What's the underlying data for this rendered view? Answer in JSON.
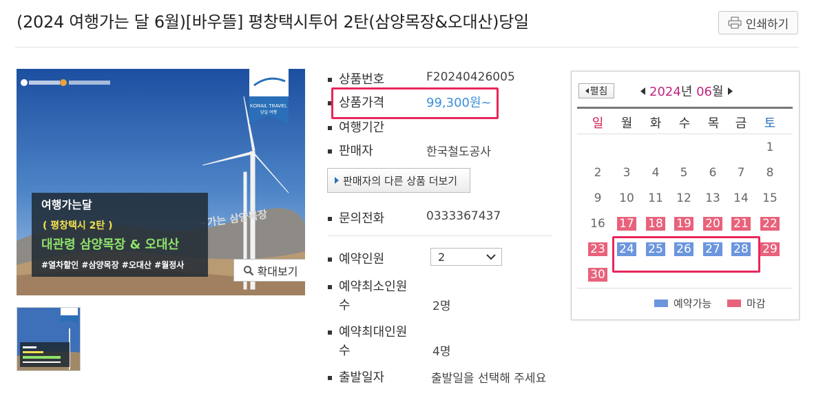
{
  "title": "(2024 여행가는 달 6월)[바우뜰] 평창택시투어 2탄(삼양목장&오대산)당일",
  "print_label": "인쇄하기",
  "zoom_label": "확대보기",
  "banner": {
    "korail_brand": "KORAIL TRAVEL",
    "korail_sub": "당일 여행",
    "headline1": "여행가는달",
    "headline2": "( 평창택시 2탄 )",
    "headline3": "대관령 삼양목장 & 오대산",
    "hashtags": "#열차할인 #삼양목장 #오대산 #월정사",
    "sign": "~가는 삼양목장"
  },
  "info": {
    "product_no_label": "상품번호",
    "product_no": "F20240426005",
    "price_label": "상품가격",
    "price": "99,300원~",
    "period_label": "여행기간",
    "seller_label": "판매자",
    "seller": "한국철도공사",
    "seller_more_label": "판매자의 다른 상품 더보기",
    "phone_label": "문의전화",
    "phone": "0333367437",
    "reserve_people_label": "예약인원",
    "reserve_people_value": "2",
    "min_people_label_1": "예약최소인원",
    "min_people_label_2": "수",
    "min_people": "2명",
    "max_people_label_1": "예약최대인원",
    "max_people_label_2": "수",
    "max_people": "4명",
    "depart_label": "출발일자",
    "depart_value": "출발일을 선택해 주세요"
  },
  "calendar": {
    "fold_label": "펼침",
    "year": "2024",
    "year_suffix": "년",
    "month": "06",
    "month_suffix": "월",
    "weekdays": [
      "일",
      "월",
      "화",
      "수",
      "목",
      "금",
      "토"
    ],
    "legend_available": "예약가능",
    "legend_closed": "마감",
    "colors": {
      "available": "#6b96de",
      "closed": "#e8627b",
      "highlight": "#e8265a"
    }
  }
}
